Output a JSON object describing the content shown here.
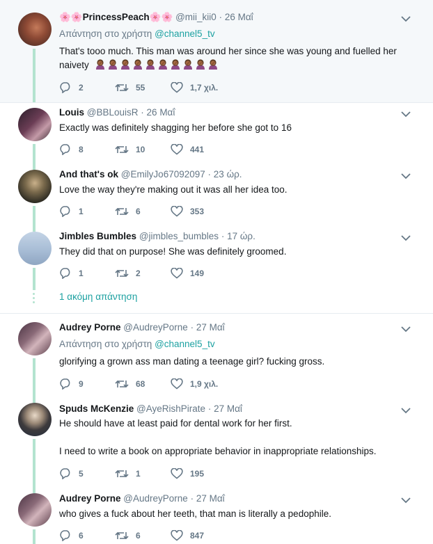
{
  "tweets": [
    {
      "name": "🌸🌸PrincessPeach🌸🌸",
      "handle": "@mii_kii0",
      "time": "26 Μαΐ",
      "reply_prefix": "Απάντηση στο χρήστη",
      "reply_mention": "@channel5_tv",
      "text_line1": "That's tooo much. This man was around her since she was young and fuelled her",
      "text_line2": "naivety",
      "emoji_icon": "woman-facepalming-emoji",
      "emoji_count": 10,
      "replies": "2",
      "retweets": "55",
      "likes": "1,7 χιλ."
    },
    {
      "name": "Louis",
      "handle": "@BBLouisR",
      "time": "26 Μαΐ",
      "text": "Exactly was definitely shagging her before she got to 16",
      "replies": "8",
      "retweets": "10",
      "likes": "441"
    },
    {
      "name": "And that's ok",
      "handle": "@EmilyJo67092097",
      "time": "23 ώρ.",
      "text": "Love the way they're making out it was all her idea too.",
      "replies": "1",
      "retweets": "6",
      "likes": "353"
    },
    {
      "name": "Jimbles Bumbles",
      "handle": "@jimbles_bumbles",
      "time": "17 ώρ.",
      "text": "They did that on purpose! She was definitely groomed.",
      "replies": "1",
      "retweets": "2",
      "likes": "149"
    },
    {
      "name": "Audrey Porne",
      "handle": "@AudreyPorne",
      "time": "27 Μαΐ",
      "reply_prefix": "Απάντηση στο χρήστη",
      "reply_mention": "@channel5_tv",
      "text": "glorifying a grown ass man dating a teenage girl? fucking gross.",
      "replies": "9",
      "retweets": "68",
      "likes": "1,9 χιλ."
    },
    {
      "name": "Spuds McKenzie",
      "handle": "@AyeRishPirate",
      "time": "27 Μαΐ",
      "text_line1": "He should have at least paid for dental work for her first.",
      "text_line2": "I need to write a book on appropriate behavior in inappropriate relationships.",
      "replies": "5",
      "retweets": "1",
      "likes": "195"
    },
    {
      "name": "Audrey Porne",
      "handle": "@AudreyPorne",
      "time": "27 Μαΐ",
      "text": "who gives a fuck about her teeth, that man is literally a pedophile.",
      "replies": "6",
      "retweets": "6",
      "likes": "847"
    }
  ],
  "more_replies": "1 ακόμη απάντηση",
  "separator": "·",
  "icons": {
    "reply": "reply-icon",
    "retweet": "retweet-icon",
    "like": "heart-icon",
    "menu": "chevron-down-icon"
  },
  "colors": {
    "accent": "#1da1a1",
    "thread_line": "#b3e3cf",
    "muted": "#657786",
    "highlight_bg": "#f5f8fa"
  }
}
